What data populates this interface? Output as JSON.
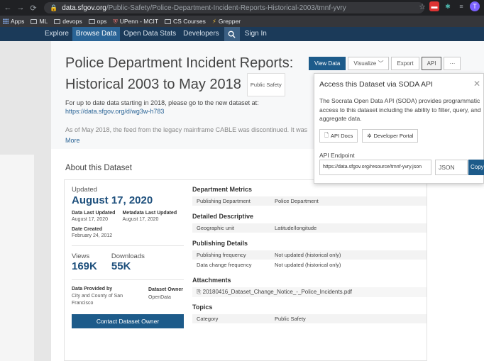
{
  "browser": {
    "url_host": "data.sfgov.org",
    "url_path": "/Public-Safety/Police-Department-Incident-Reports-Historical-2003/tmnf-yvry",
    "bookmarks": [
      "Apps",
      "ML",
      "devops",
      "ops",
      "UPenn - MCIT",
      "CS Courses",
      "Grepper"
    ],
    "profile_initial": "T"
  },
  "nav": {
    "items": [
      "Explore",
      "Browse Data",
      "Open Data Stats",
      "Developers",
      "Sign In"
    ],
    "active": "Browse Data"
  },
  "dataset": {
    "title_line1": "Police Department Incident Reports:",
    "title_line2": "Historical 2003 to May 2018",
    "category_tag": "Public Safety",
    "desc1": "For up to date data starting in 2018, please go to the new dataset at:",
    "desc_link": "https://data.sfgov.org/d/wg3w-h783",
    "desc2": "As of May 2018, the feed from the legacy mainframe CABLE was discontinued. It was",
    "more_label": "More"
  },
  "actions": {
    "view_data": "View Data",
    "visualize": "Visualize",
    "export": "Export",
    "api": "API",
    "more": "···"
  },
  "api_popover": {
    "title": "Access this Dataset via SODA API",
    "body": "The Socrata Open Data API (SODA) provides programmatic access to this dataset including the ability to filter, query, and aggregate data.",
    "api_docs": "API Docs",
    "dev_portal": "Developer Portal",
    "endpoint_label": "API Endpoint",
    "endpoint": "https://data.sfgov.org/resource/tmnf-yvry.json",
    "format": "JSON",
    "copy": "Copy"
  },
  "about": {
    "title": "About this Dataset",
    "updated_label": "Updated",
    "updated_date": "August 17, 2020",
    "data_last_updated_k": "Data Last Updated",
    "data_last_updated_v": "August 17, 2020",
    "metadata_last_updated_k": "Metadata Last Updated",
    "metadata_last_updated_v": "August 17, 2020",
    "date_created_k": "Date Created",
    "date_created_v": "February 24, 2012",
    "views_label": "Views",
    "views_value": "169K",
    "downloads_label": "Downloads",
    "downloads_value": "55K",
    "provided_by_k": "Data Provided by",
    "provided_by_v": "City and County of San Francisco",
    "dataset_owner_k": "Dataset Owner",
    "dataset_owner_v": "OpenData",
    "contact_btn": "Contact Dataset Owner"
  },
  "details": {
    "dept_title": "Department Metrics",
    "dept_rows": [
      {
        "k": "Publishing Department",
        "v": "Police Department"
      }
    ],
    "desc_title": "Detailed Descriptive",
    "desc_rows": [
      {
        "k": "Geographic unit",
        "v": "Latitude/longitude"
      }
    ],
    "pub_title": "Publishing Details",
    "pub_rows": [
      {
        "k": "Publishing frequency",
        "v": "Not updated (historical only)"
      },
      {
        "k": "Data change frequency",
        "v": "Not updated (historical only)"
      }
    ],
    "attach_title": "Attachments",
    "attachment": "20180416_Dataset_Change_Notice_-_Police_Incidents.pdf",
    "topics_title": "Topics",
    "topic_rows": [
      {
        "k": "Category",
        "v": "Public Safety"
      }
    ]
  },
  "colors": {
    "header_bg": "#1b3a59",
    "primary": "#1d5b8a",
    "accent_text": "#1d4f7c"
  }
}
